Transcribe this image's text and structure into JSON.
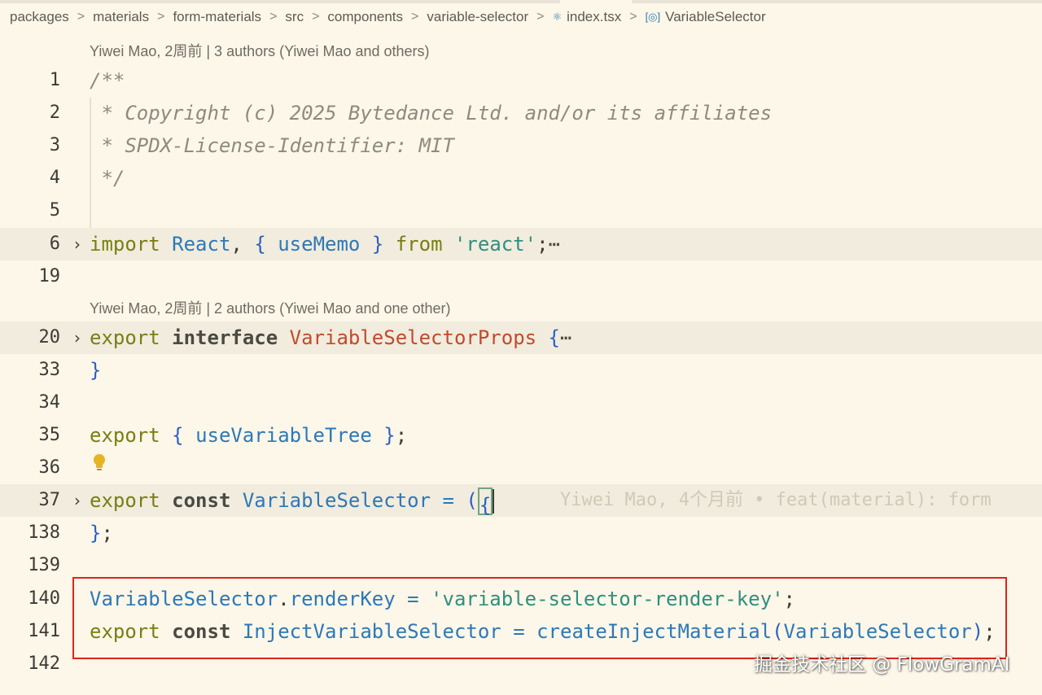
{
  "breadcrumb": {
    "items": [
      "packages",
      "materials",
      "form-materials",
      "src",
      "components",
      "variable-selector"
    ],
    "file": "index.tsx",
    "symbol": "VariableSelector",
    "separator": ">",
    "file_icon": "react-icon",
    "symbol_icon": "variable-symbol-icon"
  },
  "codelens": {
    "top": "Yiwei Mao, 2周前 | 3 authors (Yiwei Mao and others)",
    "interface": "Yiwei Mao, 2周前 | 2 authors (Yiwei Mao and one other)"
  },
  "lines": {
    "l1": {
      "num": "1",
      "code": "/**"
    },
    "l2": {
      "num": "2",
      "code": " * Copyright (c) 2025 Bytedance Ltd. and/or its affiliates"
    },
    "l3": {
      "num": "3",
      "code": " * SPDX-License-Identifier: MIT"
    },
    "l4": {
      "num": "4",
      "code": " */"
    },
    "l5": {
      "num": "5"
    },
    "l6": {
      "num": "6",
      "t": [
        "import",
        "React",
        ",",
        "{",
        "useMemo",
        "}",
        "from",
        "'react'",
        ";",
        "⋯"
      ]
    },
    "l19": {
      "num": "19"
    },
    "l20": {
      "num": "20",
      "t": [
        "export",
        "interface",
        "VariableSelectorProps",
        "{",
        "⋯"
      ]
    },
    "l33": {
      "num": "33",
      "t": [
        "}"
      ]
    },
    "l34": {
      "num": "34"
    },
    "l35": {
      "num": "35",
      "t": [
        "export",
        "{",
        "useVariableTree",
        "}",
        ";"
      ]
    },
    "l36": {
      "num": "36"
    },
    "l37": {
      "num": "37",
      "t": [
        "export",
        "const",
        "VariableSelector",
        "=",
        "(",
        "{"
      ],
      "blame": "Yiwei Mao, 4个月前 • feat(material): form"
    },
    "l138": {
      "num": "138",
      "t": [
        "}",
        ";"
      ]
    },
    "l139": {
      "num": "139"
    },
    "l140": {
      "num": "140",
      "t": [
        "VariableSelector",
        ".",
        "renderKey",
        "=",
        "'variable-selector-render-key'",
        ";"
      ]
    },
    "l141": {
      "num": "141",
      "t": [
        "export",
        "const",
        "InjectVariableSelector",
        "=",
        "createInjectMaterial",
        "(",
        "VariableSelector",
        ")",
        ";"
      ]
    },
    "l142": {
      "num": "142"
    }
  },
  "watermark": "掘金技术社区 @ FlowGramAI",
  "colors": {
    "background": "#fcf7e8",
    "keyword": "#7a7d14",
    "identifier": "#2d78b8",
    "string": "#2f8f80",
    "type_name": "#c24a2a",
    "comment": "#8f8a80",
    "highlight_box": "#e0241b"
  }
}
